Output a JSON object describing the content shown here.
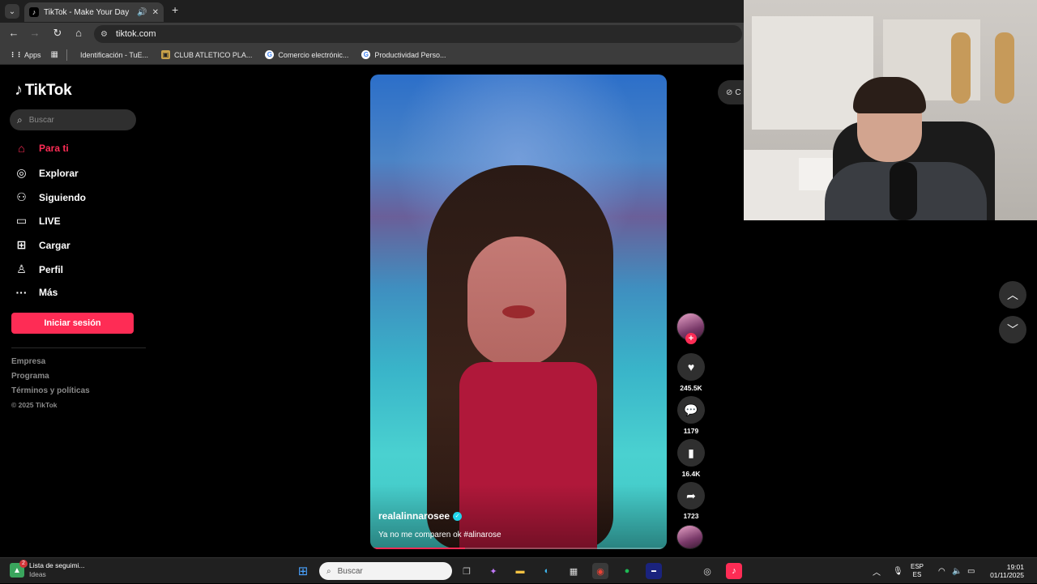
{
  "browser": {
    "tab_title": "TikTok - Make Your Day",
    "url": "tiktok.com",
    "bookmarks": [
      {
        "label": "Apps",
        "icon": "apps-grid-icon"
      },
      {
        "label": "Identificación - TuE...",
        "icon": "page-icon"
      },
      {
        "label": "CLUB ATLETICO PLA...",
        "icon": "club-icon"
      },
      {
        "label": "Comercio electrónic...",
        "icon": "google-icon"
      },
      {
        "label": "Productividad Perso...",
        "icon": "google-icon"
      }
    ]
  },
  "sidebar": {
    "logo": "TikTok",
    "search_placeholder": "Buscar",
    "nav": [
      {
        "label": "Para ti",
        "icon": "home-icon",
        "active": true
      },
      {
        "label": "Explorar",
        "icon": "compass-icon"
      },
      {
        "label": "Siguiendo",
        "icon": "following-icon"
      },
      {
        "label": "LIVE",
        "icon": "live-icon"
      },
      {
        "label": "Cargar",
        "icon": "upload-icon"
      },
      {
        "label": "Perfil",
        "icon": "profile-icon"
      },
      {
        "label": "Más",
        "icon": "more-icon"
      }
    ],
    "login_label": "Iniciar sesión",
    "footer": [
      "Empresa",
      "Programa",
      "Términos y políticas"
    ],
    "copyright": "© 2025 TikTok"
  },
  "video": {
    "username": "realalinnarosee",
    "verified": true,
    "caption": "Ya no me comparen ok #alinarose",
    "progress": 0.32
  },
  "actions": {
    "likes": "245.5K",
    "comments": "1179",
    "saves": "16.4K",
    "shares": "1723"
  },
  "right_panel": {
    "collapse_label": "C"
  },
  "taskbar": {
    "widget_title": "Lista de seguimi...",
    "widget_sub": "Ideas",
    "widget_badge": "2",
    "search_placeholder": "Buscar",
    "lang_top": "ESP",
    "lang_bottom": "ES",
    "time": "19:01",
    "date": "01/11/2025"
  },
  "colors": {
    "accent": "#fe2c55",
    "background": "#000000"
  }
}
